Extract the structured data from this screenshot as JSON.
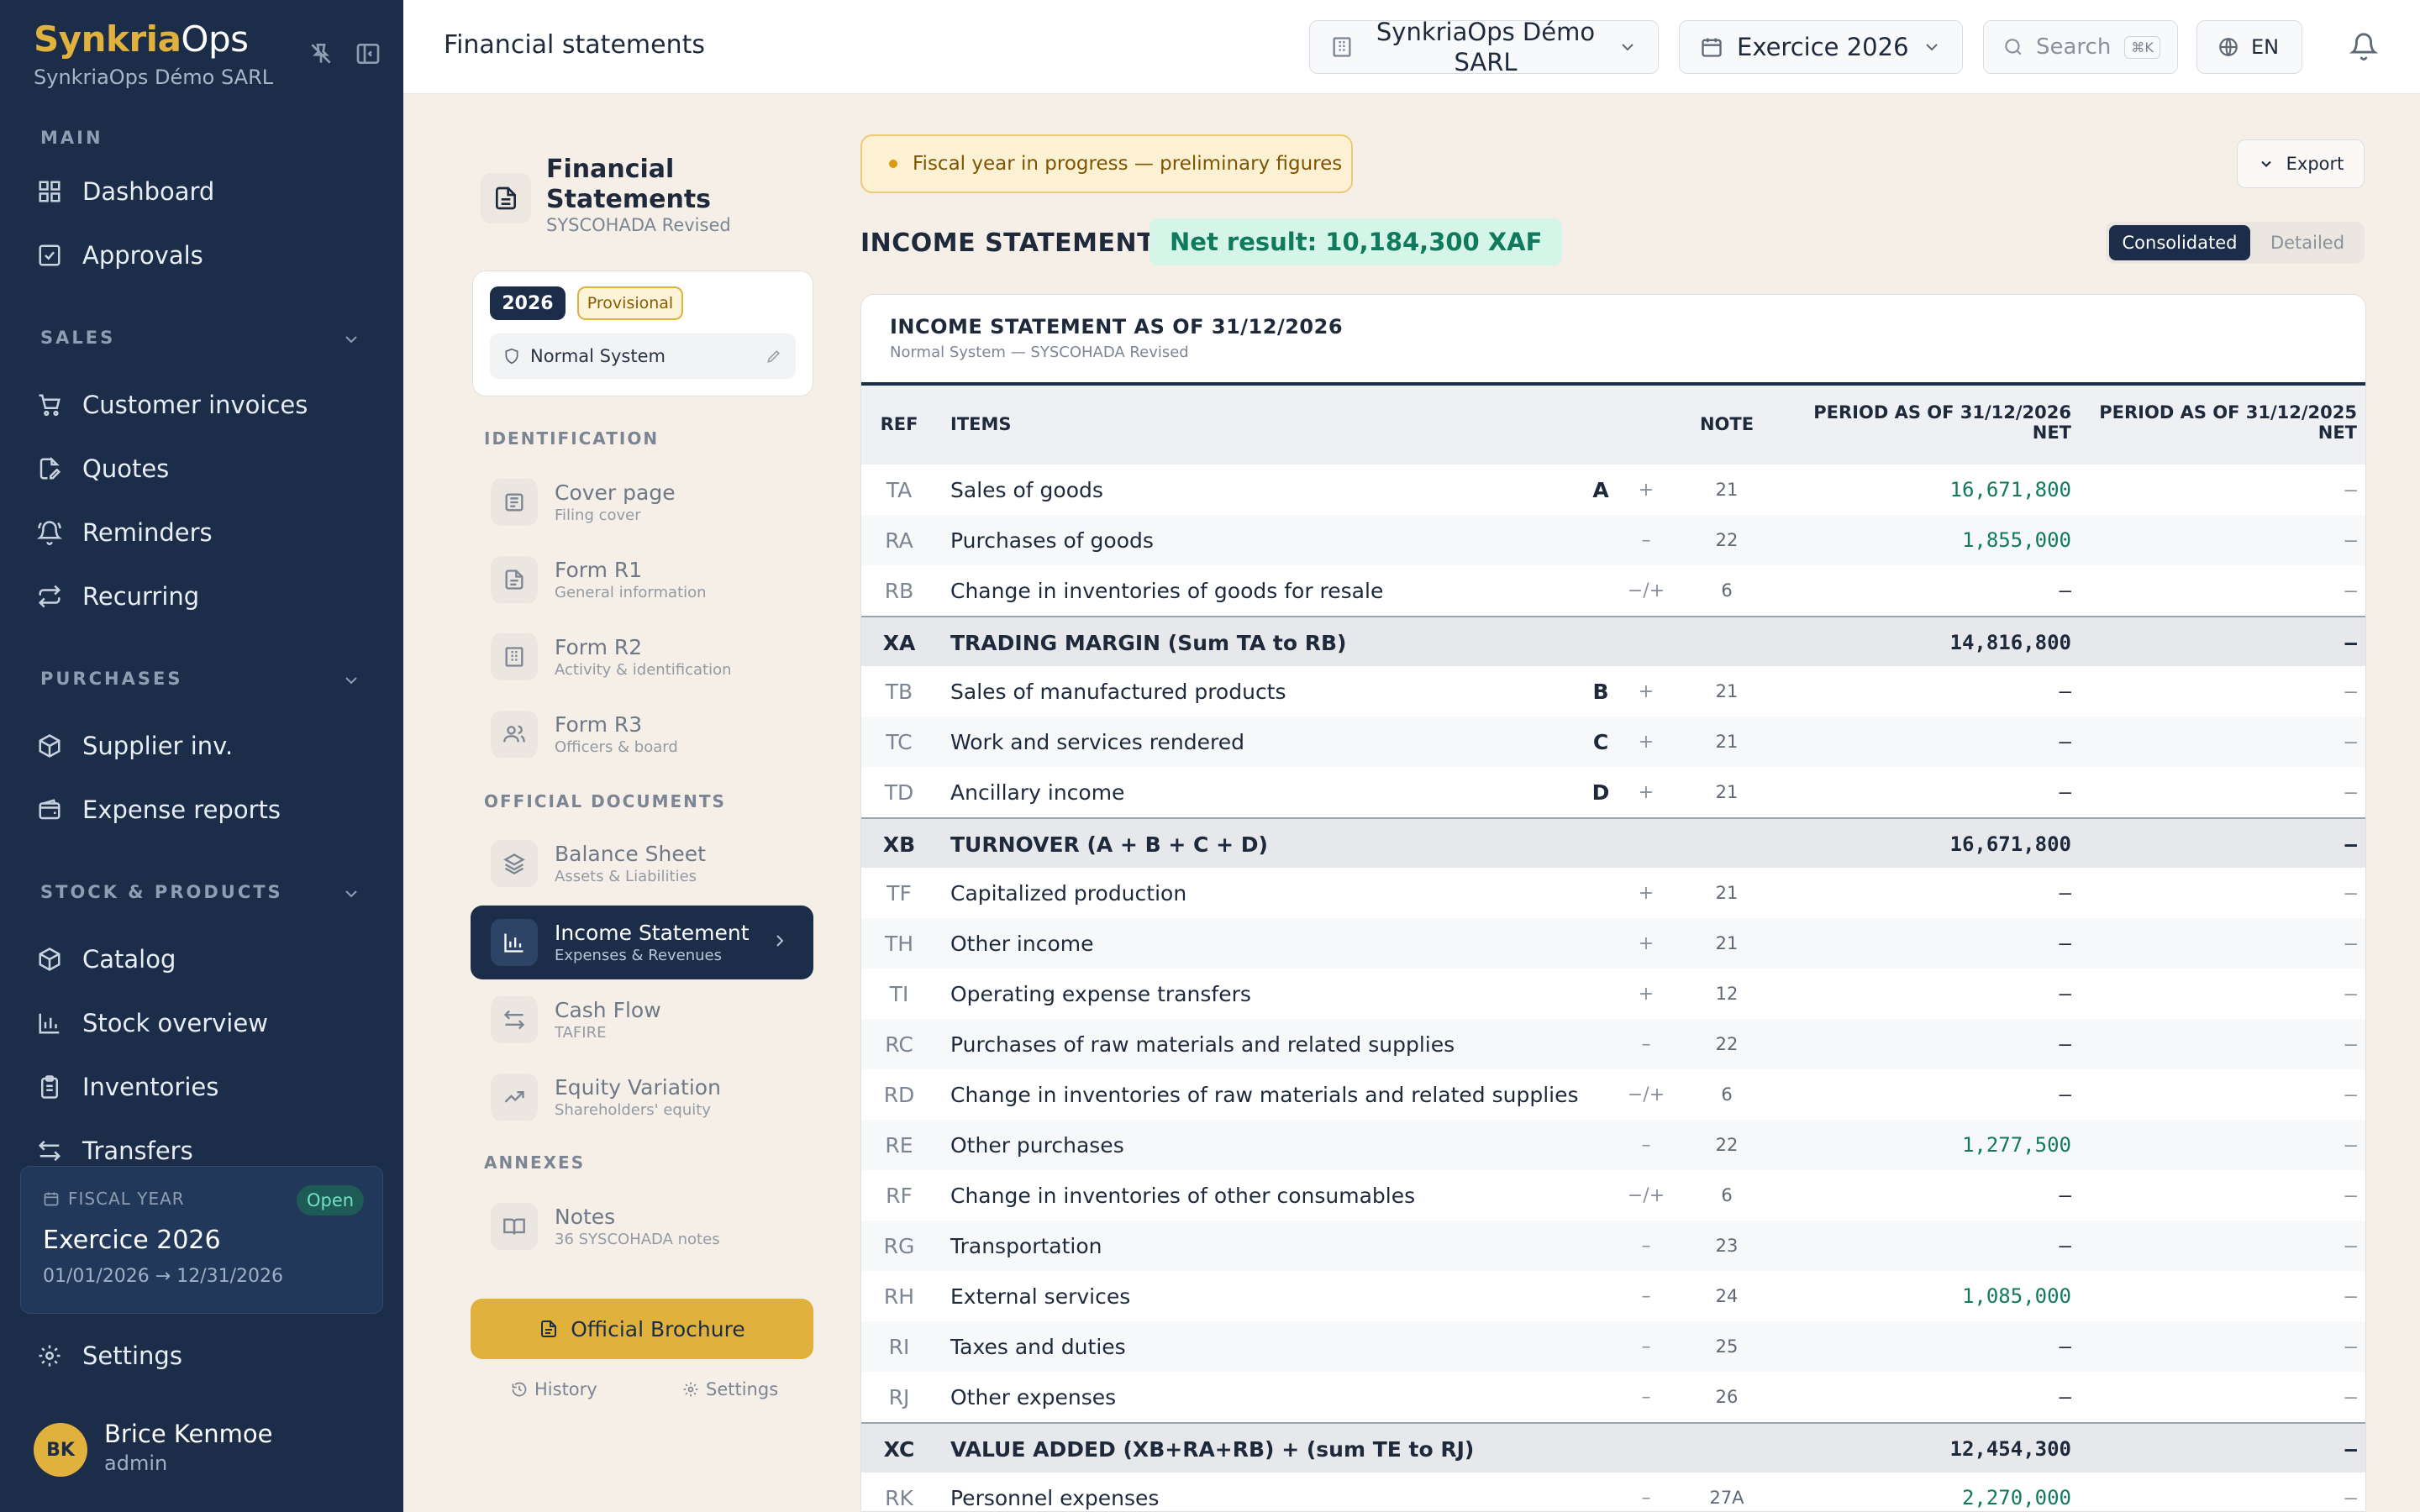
{
  "brand": {
    "name_part1": "Synkria",
    "name_part2": "Ops",
    "company": "SynkriaOps Démo SARL"
  },
  "sidebar": {
    "main_label": "MAIN",
    "main_items": [
      "Dashboard",
      "Approvals"
    ],
    "sales_label": "SALES",
    "sales_items": [
      "Customer invoices",
      "Quotes",
      "Reminders",
      "Recurring"
    ],
    "purchases_label": "PURCHASES",
    "purchases_items": [
      "Supplier inv.",
      "Expense reports"
    ],
    "stock_label": "STOCK & PRODUCTS",
    "stock_items": [
      "Catalog",
      "Stock overview",
      "Inventories",
      "Transfers"
    ],
    "fiscal_year": {
      "label": "FISCAL YEAR",
      "status": "Open",
      "title": "Exercice 2026",
      "dates": "01/01/2026 → 12/31/2026"
    },
    "settings": "Settings",
    "user": {
      "initials": "BK",
      "name": "Brice Kenmoe",
      "role": "admin"
    }
  },
  "topbar": {
    "title": "Financial statements",
    "company_select": "SynkriaOps Démo SARL",
    "year_select": "Exercice 2026",
    "search_placeholder": "Search",
    "search_shortcut": "⌘K",
    "lang": "EN"
  },
  "docnav": {
    "title": "Financial Statements",
    "subtitle": "SYSCOHADA Revised",
    "year_badge": "2026",
    "status_badge": "Provisional",
    "system": "Normal System",
    "identification_label": "IDENTIFICATION",
    "identification": [
      {
        "title": "Cover page",
        "sub": "Filing cover"
      },
      {
        "title": "Form R1",
        "sub": "General information"
      },
      {
        "title": "Form R2",
        "sub": "Activity & identification"
      },
      {
        "title": "Form R3",
        "sub": "Officers & board"
      }
    ],
    "official_label": "OFFICIAL DOCUMENTS",
    "official": [
      {
        "title": "Balance Sheet",
        "sub": "Assets & Liabilities"
      },
      {
        "title": "Income Statement",
        "sub": "Expenses & Revenues"
      },
      {
        "title": "Cash Flow",
        "sub": "TAFIRE"
      },
      {
        "title": "Equity Variation",
        "sub": "Shareholders' equity"
      }
    ],
    "annexes_label": "ANNEXES",
    "annexes": [
      {
        "title": "Notes",
        "sub": "36 SYSCOHADA notes"
      }
    ],
    "brochure": "Official Brochure",
    "history": "History",
    "settings": "Settings"
  },
  "main": {
    "alert": "Fiscal year in progress — preliminary figures",
    "export": "Export",
    "title": "INCOME STATEMENT",
    "net_result": "Net result: 10,184,300 XAF",
    "view_consolidated": "Consolidated",
    "view_detailed": "Detailed",
    "table_title": "INCOME STATEMENT AS OF 31/12/2026",
    "table_subtitle": "Normal System — SYSCOHADA Revised",
    "columns": {
      "ref": "REF",
      "items": "ITEMS",
      "note": "NOTE",
      "cur_line1": "PERIOD AS OF 31/12/2026",
      "cur_line2": "NET",
      "prev_line1": "PERIOD AS OF 31/12/2025",
      "prev_line2": "NET"
    },
    "rows": [
      {
        "ref": "TA",
        "item": "Sales of goods",
        "letter": "A",
        "sign": "+",
        "note": "21",
        "cur": "16,671,800",
        "prev": "–",
        "type": "normal",
        "green": true
      },
      {
        "ref": "RA",
        "item": "Purchases of goods",
        "letter": "",
        "sign": "–",
        "note": "22",
        "cur": "1,855,000",
        "prev": "–",
        "type": "normal",
        "green": true
      },
      {
        "ref": "RB",
        "item": "Change in inventories of goods for resale",
        "letter": "",
        "sign": "−/+",
        "note": "6",
        "cur": "–",
        "prev": "–",
        "type": "normal",
        "green": false
      },
      {
        "ref": "XA",
        "item": "TRADING MARGIN (Sum TA to RB)",
        "letter": "",
        "sign": "",
        "note": "",
        "cur": "14,816,800",
        "prev": "–",
        "type": "total",
        "green": false
      },
      {
        "ref": "TB",
        "item": "Sales of manufactured products",
        "letter": "B",
        "sign": "+",
        "note": "21",
        "cur": "–",
        "prev": "–",
        "type": "normal",
        "green": false
      },
      {
        "ref": "TC",
        "item": "Work and services rendered",
        "letter": "C",
        "sign": "+",
        "note": "21",
        "cur": "–",
        "prev": "–",
        "type": "normal",
        "green": false
      },
      {
        "ref": "TD",
        "item": "Ancillary income",
        "letter": "D",
        "sign": "+",
        "note": "21",
        "cur": "–",
        "prev": "–",
        "type": "normal",
        "green": false
      },
      {
        "ref": "XB",
        "item": "TURNOVER (A + B + C + D)",
        "letter": "",
        "sign": "",
        "note": "",
        "cur": "16,671,800",
        "prev": "–",
        "type": "total",
        "green": false
      },
      {
        "ref": "TF",
        "item": "Capitalized production",
        "letter": "",
        "sign": "+",
        "note": "21",
        "cur": "–",
        "prev": "–",
        "type": "normal",
        "green": false
      },
      {
        "ref": "TH",
        "item": "Other income",
        "letter": "",
        "sign": "+",
        "note": "21",
        "cur": "–",
        "prev": "–",
        "type": "normal",
        "green": false
      },
      {
        "ref": "TI",
        "item": "Operating expense transfers",
        "letter": "",
        "sign": "+",
        "note": "12",
        "cur": "–",
        "prev": "–",
        "type": "normal",
        "green": false
      },
      {
        "ref": "RC",
        "item": "Purchases of raw materials and related supplies",
        "letter": "",
        "sign": "–",
        "note": "22",
        "cur": "–",
        "prev": "–",
        "type": "normal",
        "green": false
      },
      {
        "ref": "RD",
        "item": "Change in inventories of raw materials and related supplies",
        "letter": "",
        "sign": "−/+",
        "note": "6",
        "cur": "–",
        "prev": "–",
        "type": "normal",
        "green": false
      },
      {
        "ref": "RE",
        "item": "Other purchases",
        "letter": "",
        "sign": "–",
        "note": "22",
        "cur": "1,277,500",
        "prev": "–",
        "type": "normal",
        "green": true
      },
      {
        "ref": "RF",
        "item": "Change in inventories of other consumables",
        "letter": "",
        "sign": "−/+",
        "note": "6",
        "cur": "–",
        "prev": "–",
        "type": "normal",
        "green": false
      },
      {
        "ref": "RG",
        "item": "Transportation",
        "letter": "",
        "sign": "–",
        "note": "23",
        "cur": "–",
        "prev": "–",
        "type": "normal",
        "green": false
      },
      {
        "ref": "RH",
        "item": "External services",
        "letter": "",
        "sign": "–",
        "note": "24",
        "cur": "1,085,000",
        "prev": "–",
        "type": "normal",
        "green": true
      },
      {
        "ref": "RI",
        "item": "Taxes and duties",
        "letter": "",
        "sign": "–",
        "note": "25",
        "cur": "–",
        "prev": "–",
        "type": "normal",
        "green": false
      },
      {
        "ref": "RJ",
        "item": "Other expenses",
        "letter": "",
        "sign": "–",
        "note": "26",
        "cur": "–",
        "prev": "–",
        "type": "normal",
        "green": false
      },
      {
        "ref": "XC",
        "item": "VALUE ADDED (XB+RA+RB) + (sum TE to RJ)",
        "letter": "",
        "sign": "",
        "note": "",
        "cur": "12,454,300",
        "prev": "–",
        "type": "total",
        "green": false
      },
      {
        "ref": "RK",
        "item": "Personnel expenses",
        "letter": "",
        "sign": "–",
        "note": "27A",
        "cur": "2,270,000",
        "prev": "–",
        "type": "normal",
        "green": true
      }
    ]
  }
}
